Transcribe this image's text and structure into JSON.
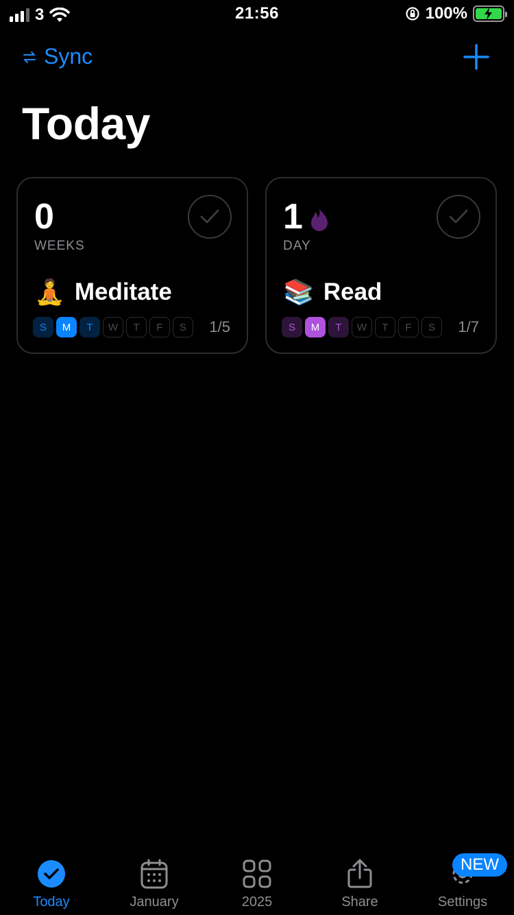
{
  "status_bar": {
    "carrier": "3",
    "time": "21:56",
    "battery_percent": "100%"
  },
  "nav": {
    "sync_label": "Sync",
    "add_icon": "plus-icon"
  },
  "page_title": "Today",
  "habits": [
    {
      "streak": "0",
      "unit": "WEEKS",
      "emoji": "🧘",
      "name": "Meditate",
      "progress": "1/5",
      "color": "#0a84ff",
      "days": [
        {
          "letter": "S",
          "state": "light"
        },
        {
          "letter": "M",
          "state": "full"
        },
        {
          "letter": "T",
          "state": "light"
        },
        {
          "letter": "W",
          "state": "empty"
        },
        {
          "letter": "T",
          "state": "empty"
        },
        {
          "letter": "F",
          "state": "empty"
        },
        {
          "letter": "S",
          "state": "empty"
        }
      ]
    },
    {
      "streak": "1",
      "unit": "DAY",
      "emoji": "📚",
      "name": "Read",
      "progress": "1/7",
      "color": "#af52de",
      "streak_icon": "flame-icon",
      "days": [
        {
          "letter": "S",
          "state": "light"
        },
        {
          "letter": "M",
          "state": "full"
        },
        {
          "letter": "T",
          "state": "light"
        },
        {
          "letter": "W",
          "state": "empty"
        },
        {
          "letter": "T",
          "state": "empty"
        },
        {
          "letter": "F",
          "state": "empty"
        },
        {
          "letter": "S",
          "state": "empty"
        }
      ]
    }
  ],
  "tabs": [
    {
      "label": "Today",
      "icon": "check-circle-icon",
      "active": true
    },
    {
      "label": "January",
      "icon": "calendar-icon",
      "active": false
    },
    {
      "label": "2025",
      "icon": "grid-icon",
      "active": false
    },
    {
      "label": "Share",
      "icon": "share-icon",
      "active": false
    },
    {
      "label": "Settings",
      "icon": "gear-icon",
      "active": false,
      "badge": "NEW"
    }
  ],
  "colors": {
    "accent": "#1a8cff",
    "background": "#000000"
  }
}
